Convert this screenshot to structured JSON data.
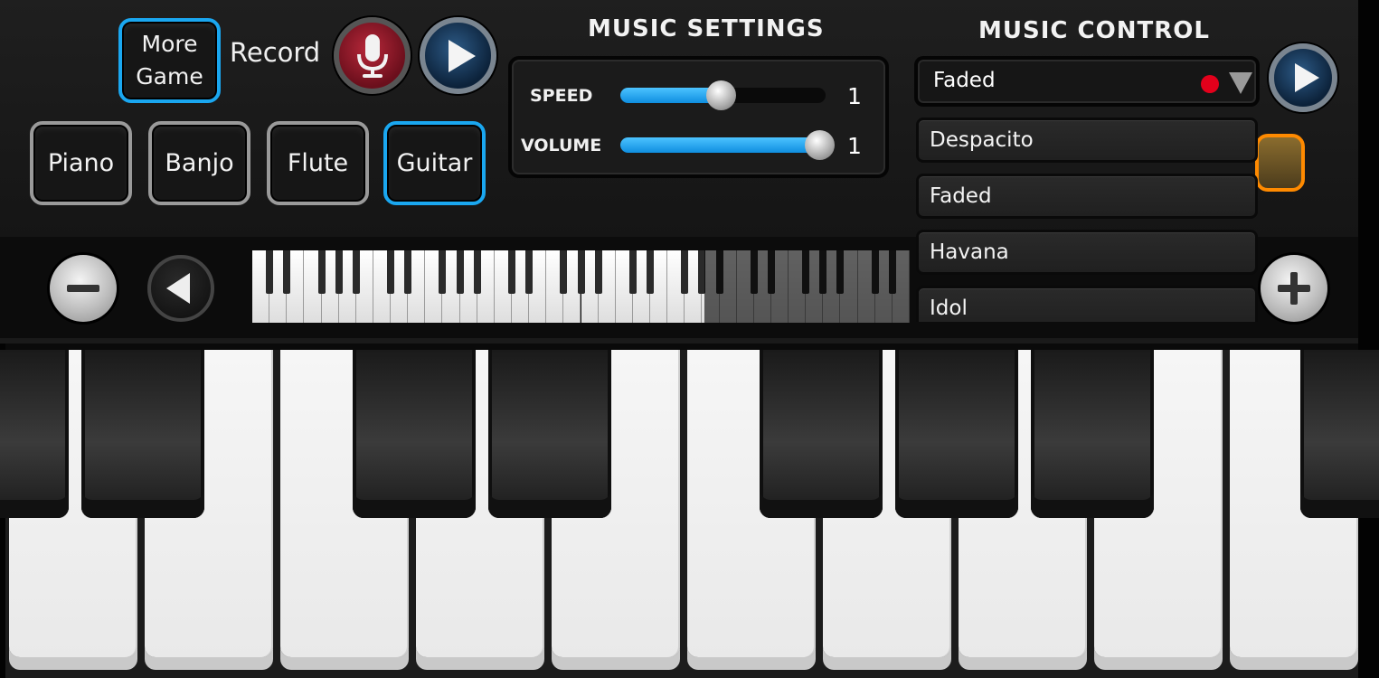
{
  "header": {
    "more_game_line1": "More",
    "more_game_line2": "Game",
    "record_label": "Record"
  },
  "instruments": {
    "items": [
      "Piano",
      "Banjo",
      "Flute",
      "Guitar"
    ],
    "selected": "Guitar"
  },
  "music_settings": {
    "title": "MUSIC SETTINGS",
    "speed": {
      "label": "SPEED",
      "value": "1",
      "level": 0.49
    },
    "volume": {
      "label": "VOLUME",
      "value": "1",
      "level": 0.97
    }
  },
  "music_control": {
    "title": "MUSIC CONTROL",
    "selected_song": "Faded",
    "songs": [
      "Despacito",
      "Faded",
      "Havana",
      "Idol"
    ]
  },
  "colors": {
    "accent_blue": "#1aa7f0",
    "record_red": "#b8283a",
    "status_dot": "#e3001b",
    "orange_button": "#ff8a00"
  },
  "icons": {
    "mic": "microphone-icon",
    "play": "play-icon",
    "dropdown": "triangle-down-icon",
    "minus": "minus-icon",
    "plus": "plus-icon",
    "left": "triangle-left-icon"
  }
}
